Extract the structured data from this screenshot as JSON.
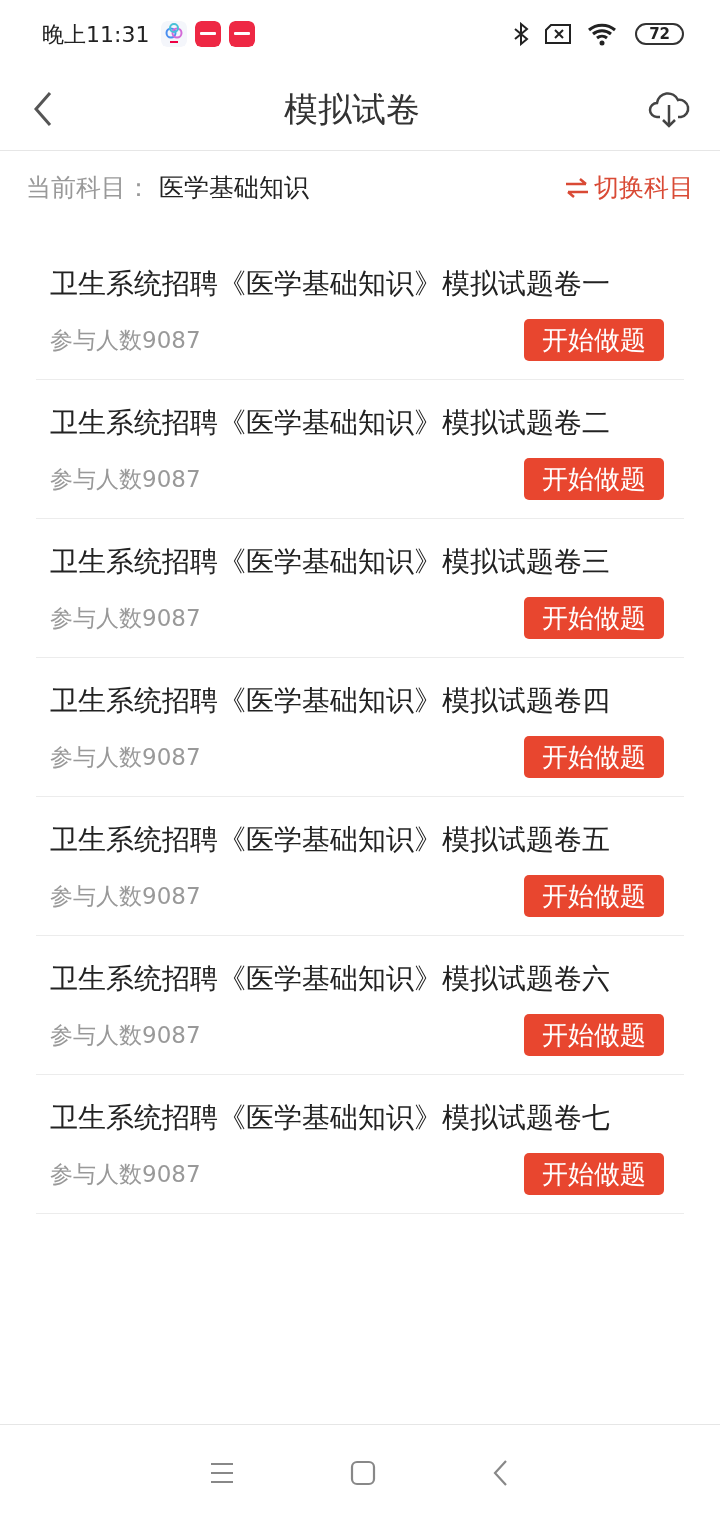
{
  "status_bar": {
    "time": "晚上11:31",
    "battery": "72"
  },
  "header": {
    "title": "模拟试卷"
  },
  "subject_bar": {
    "label": "当前科目：",
    "subject": "医学基础知识",
    "switch_label": "切换科目"
  },
  "papers": [
    {
      "title": "卫生系统招聘《医学基础知识》模拟试题卷一",
      "participants": "参与人数9087",
      "button": "开始做题"
    },
    {
      "title": "卫生系统招聘《医学基础知识》模拟试题卷二",
      "participants": "参与人数9087",
      "button": "开始做题"
    },
    {
      "title": "卫生系统招聘《医学基础知识》模拟试题卷三",
      "participants": "参与人数9087",
      "button": "开始做题"
    },
    {
      "title": "卫生系统招聘《医学基础知识》模拟试题卷四",
      "participants": "参与人数9087",
      "button": "开始做题"
    },
    {
      "title": "卫生系统招聘《医学基础知识》模拟试题卷五",
      "participants": "参与人数9087",
      "button": "开始做题"
    },
    {
      "title": "卫生系统招聘《医学基础知识》模拟试题卷六",
      "participants": "参与人数9087",
      "button": "开始做题"
    },
    {
      "title": "卫生系统招聘《医学基础知识》模拟试题卷七",
      "participants": "参与人数9087",
      "button": "开始做题"
    }
  ]
}
